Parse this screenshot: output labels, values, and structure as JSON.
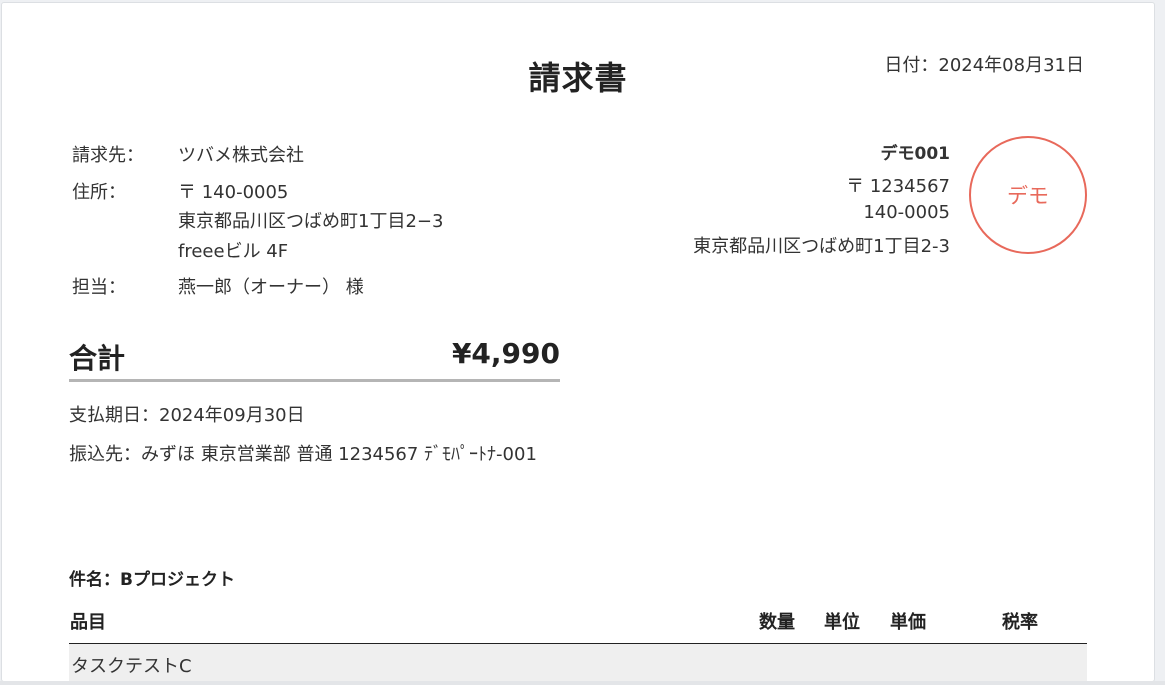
{
  "invoice": {
    "title": "請求書",
    "date": "日付：2024年08月31日"
  },
  "billing": {
    "to_label": "請求先：",
    "to_value": "ツバメ株式会社",
    "address_label": "住所：",
    "address_lines": [
      "〒 140-0005",
      "東京都品川区つばめ町1丁目2−3",
      "freeeビル 4F"
    ],
    "contact_label": "担当：",
    "contact_value": "燕一郎（オーナー） 様"
  },
  "sender": {
    "name": "デモ001",
    "lines": [
      "〒 1234567",
      "140-0005",
      "東京都品川区つばめ町1丁目2-3"
    ],
    "stamp_text": "デモ"
  },
  "total": {
    "label": "合計",
    "value": "¥4,990"
  },
  "payment": {
    "due": "支払期日：2024年09月30日",
    "bank": "振込先：みずほ 東京営業部 普通 1234567 ﾃﾞﾓﾊﾟｰﾄﾅ-001"
  },
  "subject": "件名：Bプロジェクト",
  "table": {
    "headers": {
      "item": "品目",
      "qty": "数量",
      "unit": "単位",
      "price": "単価",
      "tax": "税率"
    },
    "rows": [
      {
        "item": "タスクテストC"
      }
    ]
  },
  "colors": {
    "stamp": "#e8695b",
    "row_bg": "#efefef",
    "total_rule": "#b5b5b5"
  }
}
